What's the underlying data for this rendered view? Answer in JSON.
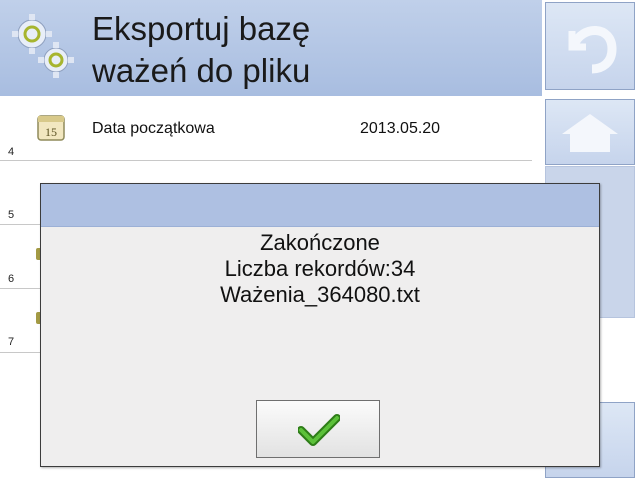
{
  "header": {
    "title_line1": "Eksportuj bazę",
    "title_line2": "ważeń do pliku",
    "icon": "gear-icon"
  },
  "side_buttons": [
    {
      "name": "back",
      "icon": "back-arrow-icon"
    },
    {
      "name": "home",
      "icon": "home-icon"
    }
  ],
  "list": {
    "rows": [
      {
        "number": "4",
        "label": "Data początkowa",
        "value": "2013.05.20",
        "icon": "calendar-icon",
        "icon_text": "15"
      },
      {
        "number": "5"
      },
      {
        "number": "6"
      },
      {
        "number": "7"
      }
    ]
  },
  "dialog": {
    "line1": "Zakończone",
    "line2": "Liczba rekordów:34",
    "line3": "Ważenia_364080.txt",
    "ok_icon": "checkmark-icon"
  },
  "colors": {
    "header_bg": "#b4c6e6",
    "dialog_bar": "#aec0e2",
    "dialog_bg": "#efeeee",
    "check_green": "#3f9a23"
  }
}
